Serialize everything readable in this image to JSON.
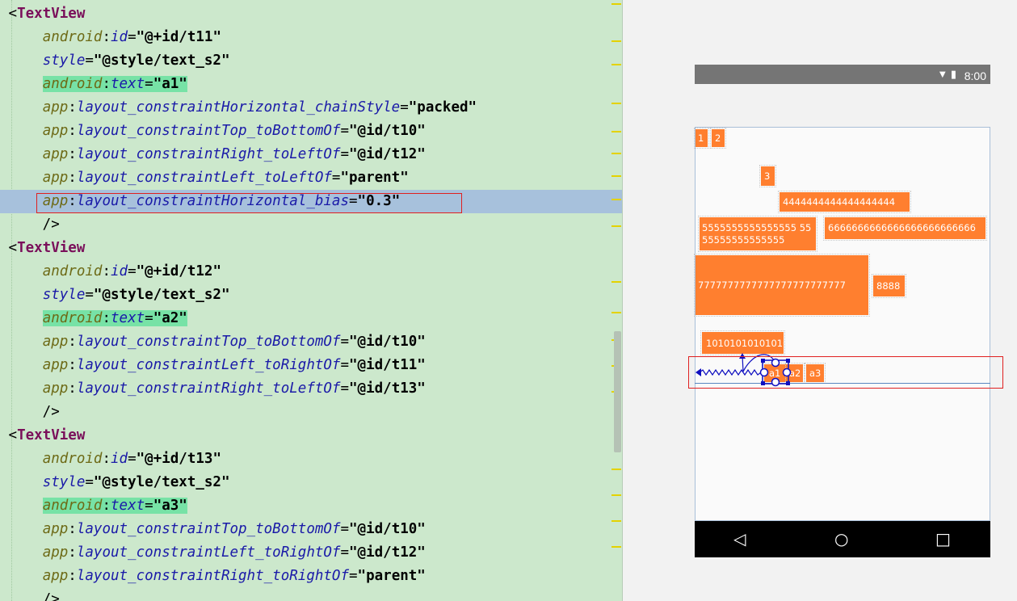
{
  "editor": {
    "lines": [
      {
        "k": "tag",
        "tag": "TextView"
      },
      {
        "k": "attr",
        "ns": "android",
        "attr": "id",
        "val": "@+id/t11"
      },
      {
        "k": "attr",
        "ns": "",
        "attr": "style",
        "val": "@style/text_s2"
      },
      {
        "k": "attr",
        "ns": "android",
        "attr": "text",
        "val": "a1",
        "mark": true
      },
      {
        "k": "attr",
        "ns": "app",
        "attr": "layout_constraintHorizontal_chainStyle",
        "val": "packed"
      },
      {
        "k": "attr",
        "ns": "app",
        "attr": "layout_constraintTop_toBottomOf",
        "val": "@id/t10"
      },
      {
        "k": "attr",
        "ns": "app",
        "attr": "layout_constraintRight_toLeftOf",
        "val": "@id/t12"
      },
      {
        "k": "attr",
        "ns": "app",
        "attr": "layout_constraintLeft_toLeftOf",
        "val": "parent"
      },
      {
        "k": "attr",
        "ns": "app",
        "attr": "layout_constraintHorizontal_bias",
        "val": "0.3",
        "hl": true
      },
      {
        "k": "close"
      },
      {
        "k": "tag",
        "tag": "TextView"
      },
      {
        "k": "attr",
        "ns": "android",
        "attr": "id",
        "val": "@+id/t12"
      },
      {
        "k": "attr",
        "ns": "",
        "attr": "style",
        "val": "@style/text_s2"
      },
      {
        "k": "attr",
        "ns": "android",
        "attr": "text",
        "val": "a2",
        "mark": true
      },
      {
        "k": "attr",
        "ns": "app",
        "attr": "layout_constraintTop_toBottomOf",
        "val": "@id/t10"
      },
      {
        "k": "attr",
        "ns": "app",
        "attr": "layout_constraintLeft_toRightOf",
        "val": "@id/t11"
      },
      {
        "k": "attr",
        "ns": "app",
        "attr": "layout_constraintRight_toLeftOf",
        "val": "@id/t13"
      },
      {
        "k": "close"
      },
      {
        "k": "tag",
        "tag": "TextView"
      },
      {
        "k": "attr",
        "ns": "android",
        "attr": "id",
        "val": "@+id/t13"
      },
      {
        "k": "attr",
        "ns": "",
        "attr": "style",
        "val": "@style/text_s2"
      },
      {
        "k": "attr",
        "ns": "android",
        "attr": "text",
        "val": "a3",
        "mark": true
      },
      {
        "k": "attr",
        "ns": "app",
        "attr": "layout_constraintTop_toBottomOf",
        "val": "@id/t10"
      },
      {
        "k": "attr",
        "ns": "app",
        "attr": "layout_constraintLeft_toRightOf",
        "val": "@id/t12"
      },
      {
        "k": "attr",
        "ns": "app",
        "attr": "layout_constraintRight_toRightOf",
        "val": "parent"
      },
      {
        "k": "close"
      }
    ]
  },
  "preview": {
    "status_time": "8:00",
    "status_icons": "▼ ▮",
    "nav": {
      "back": "◁",
      "home": "○",
      "recent": "□"
    },
    "views": [
      {
        "id": "t1",
        "text": "1"
      },
      {
        "id": "t2",
        "text": "2"
      },
      {
        "id": "t3",
        "text": "3"
      },
      {
        "id": "t4",
        "text": "4444444444444444444"
      },
      {
        "id": "t5",
        "text": "5555555555555555 5555555555555555"
      },
      {
        "id": "t6",
        "text": "6666666666666666666666666"
      },
      {
        "id": "t7",
        "text": "7777777777777777777777777"
      },
      {
        "id": "t8",
        "text": "8888"
      },
      {
        "id": "t10",
        "text": "1010101010101010"
      },
      {
        "id": "t11",
        "text": "a1"
      },
      {
        "id": "t12",
        "text": "a2"
      },
      {
        "id": "t13",
        "text": "a3"
      }
    ]
  },
  "colors": {
    "editor_bg": "#cce8cc",
    "highlight": "#a7c1dc",
    "view_fill": "#ff7f2f",
    "annotation": "#e02020",
    "constraint": "#1010c0"
  }
}
